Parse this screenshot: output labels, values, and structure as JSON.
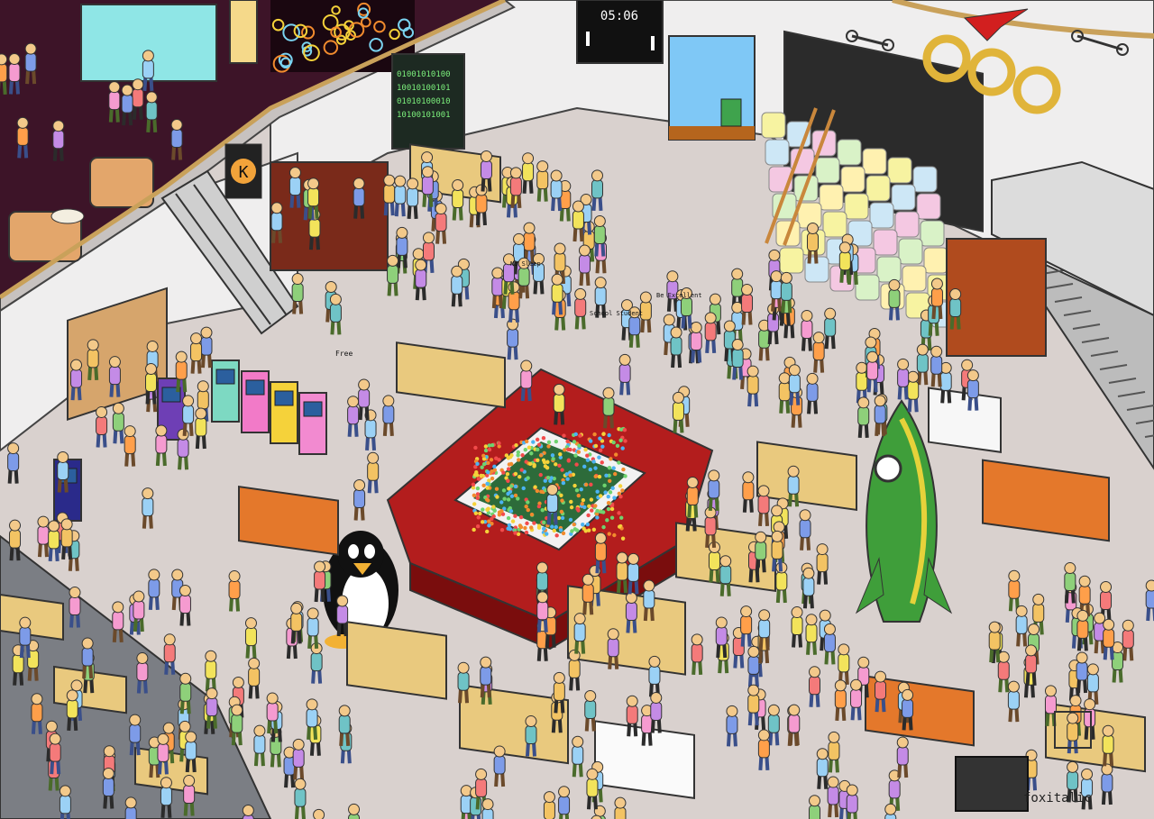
{
  "scene": {
    "description_free": true,
    "scoreboard_time": "05:06",
    "binary_board_lines": [
      "01001010100",
      "10010100101",
      "01010100010",
      "10100101001"
    ],
    "sign_logo_letter": "K",
    "signature": "foxitalic",
    "penguin_badge_text": "",
    "speech_texts": [
      "Free",
      "No Sleep",
      "School Student",
      "Be Excellent"
    ]
  },
  "palette": {
    "floor": "#d9d1ce",
    "upper_floor": "#3d1428",
    "wall": "#efeeee",
    "wall_line": "#444444",
    "ball_pit_red": "#b31d1d",
    "ball_pit_dark": "#7a0d0d",
    "grey_floor": "#7b7e84",
    "table_tan": "#e9c97e",
    "table_orange": "#e4782b",
    "rocket_green": "#3f9e3a",
    "rocket_yellow": "#e6d23a",
    "rope": "#c9a15a",
    "cube_wall": [
      "#f7f3a1",
      "#cde7f6",
      "#f4c8e2",
      "#d9f2c7",
      "#fff1b0"
    ],
    "people": [
      "#f3c363",
      "#9bd1f5",
      "#f47a7a",
      "#8ed07a",
      "#c48be6",
      "#6fc3c6",
      "#f59bd0",
      "#f2e35b",
      "#7d9be8",
      "#ff9f4a"
    ]
  }
}
